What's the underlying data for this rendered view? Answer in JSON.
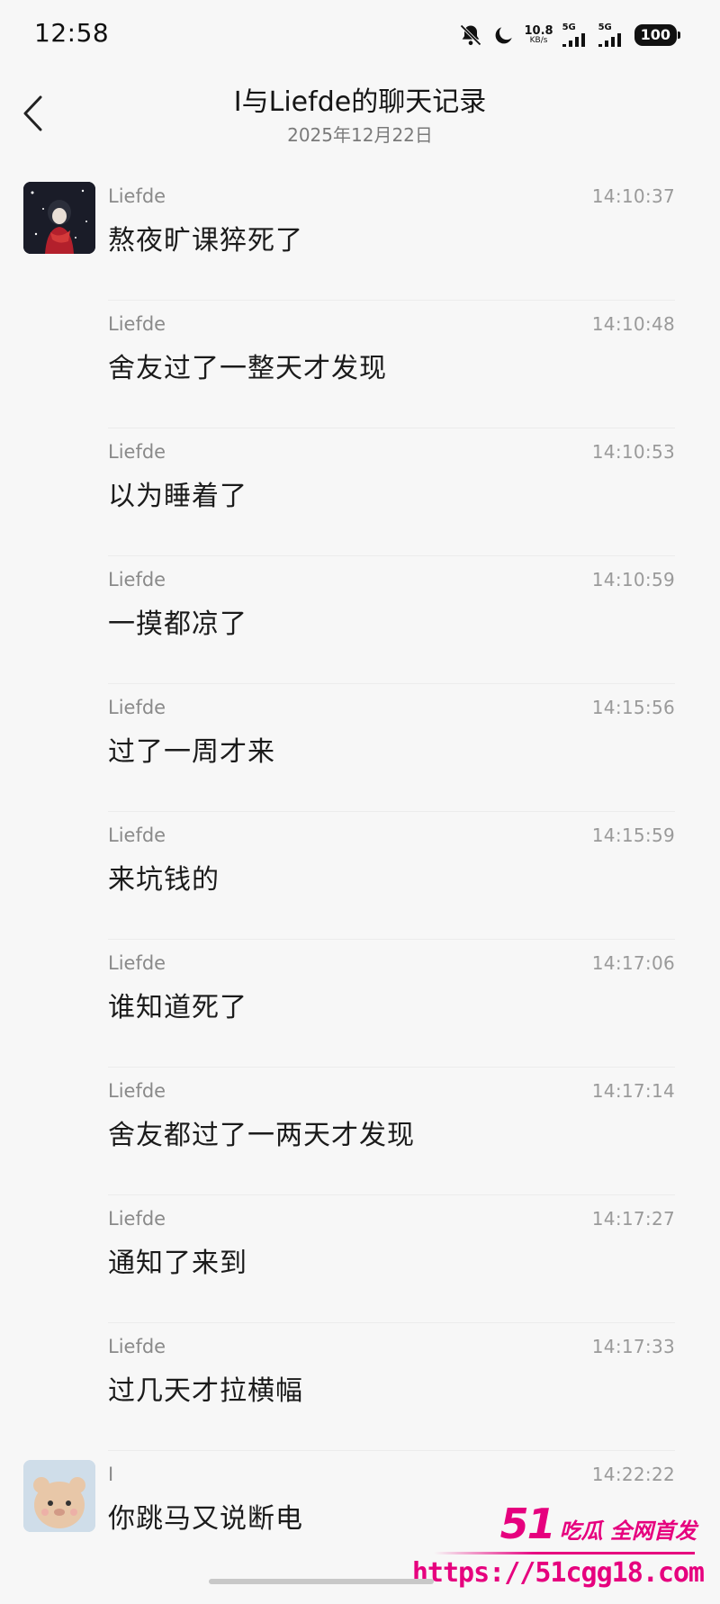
{
  "status_bar": {
    "time": "12:58",
    "net_speed_value": "10.8",
    "net_speed_unit": "KB/s",
    "signal1_label": "5G",
    "signal2_label": "5G",
    "battery": "100",
    "icons": [
      "bell-off-icon",
      "moon-icon",
      "signal-icon",
      "signal-icon",
      "battery-icon"
    ]
  },
  "header": {
    "title": "I与Liefde的聊天记录",
    "subtitle": "2025年12月22日",
    "back_icon": "chevron-left-icon"
  },
  "messages": [
    {
      "name": "Liefde",
      "time": "14:10:37",
      "text": "熬夜旷课猝死了",
      "avatar": "avatar-liefde"
    },
    {
      "name": "Liefde",
      "time": "14:10:48",
      "text": "舍友过了一整天才发现"
    },
    {
      "name": "Liefde",
      "time": "14:10:53",
      "text": "以为睡着了"
    },
    {
      "name": "Liefde",
      "time": "14:10:59",
      "text": "一摸都凉了"
    },
    {
      "name": "Liefde",
      "time": "14:15:56",
      "text": "过了一周才来"
    },
    {
      "name": "Liefde",
      "time": "14:15:59",
      "text": "来坑钱的"
    },
    {
      "name": "Liefde",
      "time": "14:17:06",
      "text": "谁知道死了"
    },
    {
      "name": "Liefde",
      "time": "14:17:14",
      "text": "舍友都过了一两天才发现"
    },
    {
      "name": "Liefde",
      "time": "14:17:27",
      "text": "通知了来到"
    },
    {
      "name": "Liefde",
      "time": "14:17:33",
      "text": "过几天才拉横幅"
    },
    {
      "name": "I",
      "time": "14:22:22",
      "text": "你跳马又说断电",
      "avatar": "avatar-i"
    }
  ],
  "watermark": {
    "brand_num": "51",
    "brand_text": "吃瓜 全网首发",
    "url": "https://51cgg18.com"
  },
  "colors": {
    "background": "#f7f7f7",
    "watermark": "#e6007e",
    "name_gray": "#8a8a8a",
    "time_gray": "#9a9a9a"
  }
}
